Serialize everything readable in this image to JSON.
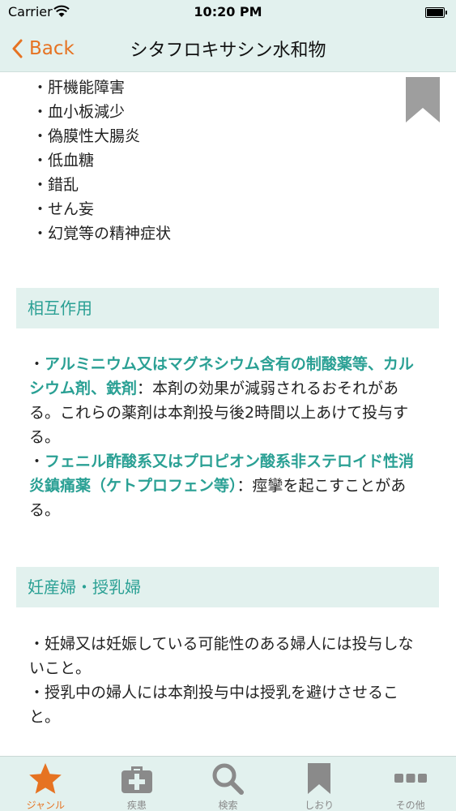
{
  "status_bar": {
    "carrier": "Carrier",
    "time": "10:20 PM"
  },
  "nav": {
    "back_label": "Back",
    "title": "シタフロキサシン水和物"
  },
  "side_effects": [
    "肝機能障害",
    "血小板減少",
    "偽膜性大腸炎",
    "低血糖",
    "錯乱",
    "せん妄",
    "幻覚等の精神症状"
  ],
  "interactions": {
    "header": "相互作用",
    "item1_highlight": "アルミニウム又はマグネシウム含有の制酸薬等、カルシウム剤、鉄剤",
    "item1_text": "：本剤の効果が減弱されるおそれがある。これらの薬剤は本剤投与後2時間以上あけて投与する。",
    "item2_highlight": "フェニル酢酸系又はプロピオン酸系非ステロイド性消炎鎮痛薬（ケトプロフェン等）",
    "item2_text": "：痙攣を起こすことがある。"
  },
  "pregnancy": {
    "header": "妊産婦・授乳婦",
    "item1": "妊婦又は妊娠している可能性のある婦人には投与しないこと。",
    "item2": "授乳中の婦人には本剤投与中は授乳を避けさせること。"
  },
  "bullet": "・",
  "tabs": [
    {
      "label": "ジャンル",
      "icon": "star-icon",
      "active": true
    },
    {
      "label": "疾患",
      "icon": "medical-bag-icon",
      "active": false
    },
    {
      "label": "検索",
      "icon": "search-icon",
      "active": false
    },
    {
      "label": "しおり",
      "icon": "bookmark-icon",
      "active": false
    },
    {
      "label": "その他",
      "icon": "more-icon",
      "active": false
    }
  ],
  "colors": {
    "accent": "#e67322",
    "teal": "#2aa094",
    "bar_bg": "#e2f1ee",
    "inactive": "#8a8a8a"
  }
}
